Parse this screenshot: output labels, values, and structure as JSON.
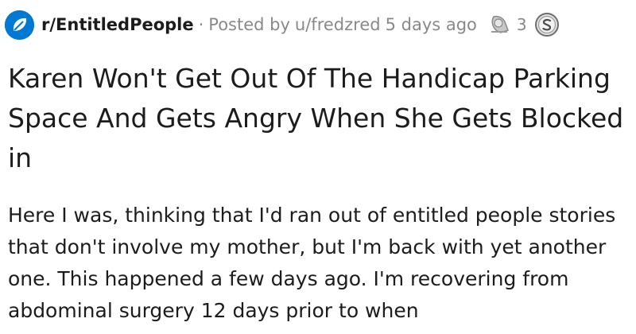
{
  "post": {
    "subreddit": "r/EntitledPeople",
    "separator": "·",
    "posted_prefix": "Posted by",
    "author": "u/fredzred",
    "time_ago": "5 days ago",
    "awards": [
      {
        "icon": "silver-award-icon",
        "count": "3"
      },
      {
        "icon": "silver-coin-award-icon",
        "count": ""
      }
    ],
    "title": "Karen Won't Get Out Of The Handicap Parking Space And Gets Angry When She Gets Blocked in",
    "body": "Here I was, thinking that I'd ran out of entitled people stories that don't involve my mother, but I'm back with yet another one. This happened a few days ago. I'm recovering from abdominal surgery 12 days prior to when"
  },
  "colors": {
    "subreddit_icon_bg": "#0079d3",
    "meta_text": "#878a8c",
    "title_text": "#1c1c1c",
    "body_text": "#1c1c1c"
  }
}
